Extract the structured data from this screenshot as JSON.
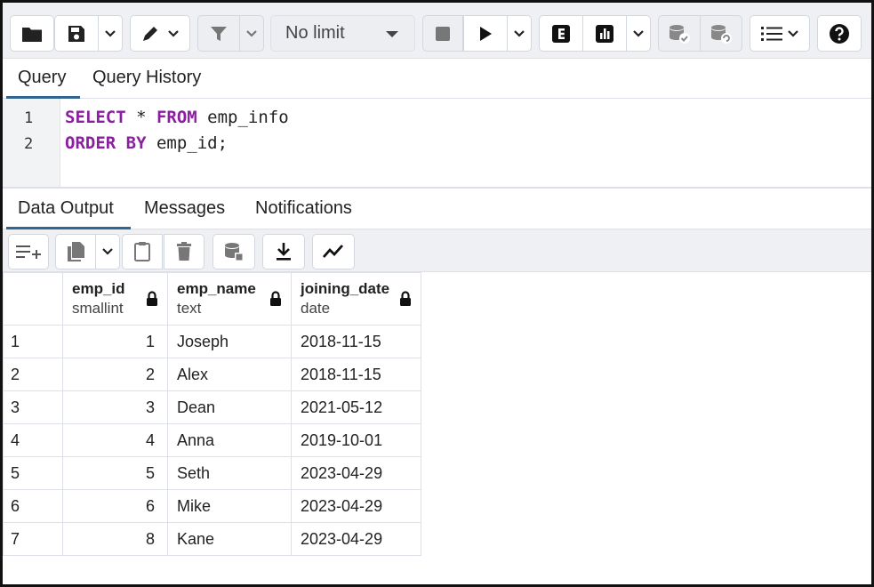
{
  "toolbar": {
    "limit_value": "No limit",
    "icons": [
      "folder-icon",
      "save-icon",
      "chevron-down-icon",
      "pen-icon",
      "filter-icon",
      "stop-icon",
      "play-icon",
      "explain-icon",
      "analyze-icon",
      "commit-icon",
      "rollback-icon",
      "macros-icon",
      "help-icon"
    ]
  },
  "query_tabs": {
    "query": "Query",
    "history": "Query History"
  },
  "editor": {
    "lines": [
      {
        "num": "1",
        "kw1": "SELECT",
        "mid": " * ",
        "kw2": "FROM",
        "rest": " emp_info"
      },
      {
        "num": "2",
        "kw1": "ORDER BY",
        "mid": " emp_id;",
        "kw2": "",
        "rest": ""
      }
    ],
    "keyword_color": "#8b1fa0"
  },
  "output_tabs": {
    "data_output": "Data Output",
    "messages": "Messages",
    "notifications": "Notifications"
  },
  "grid": {
    "columns": [
      {
        "name": "emp_id",
        "type": "smallint"
      },
      {
        "name": "emp_name",
        "type": "text"
      },
      {
        "name": "joining_date",
        "type": "date"
      }
    ],
    "rows": [
      {
        "rn": "1",
        "emp_id": "1",
        "emp_name": "Joseph",
        "joining_date": "2018-11-15"
      },
      {
        "rn": "2",
        "emp_id": "2",
        "emp_name": "Alex",
        "joining_date": "2018-11-15"
      },
      {
        "rn": "3",
        "emp_id": "3",
        "emp_name": "Dean",
        "joining_date": "2021-05-12"
      },
      {
        "rn": "4",
        "emp_id": "4",
        "emp_name": "Anna",
        "joining_date": "2019-10-01"
      },
      {
        "rn": "5",
        "emp_id": "5",
        "emp_name": "Seth",
        "joining_date": "2023-04-29"
      },
      {
        "rn": "6",
        "emp_id": "6",
        "emp_name": "Mike",
        "joining_date": "2023-04-29"
      },
      {
        "rn": "7",
        "emp_id": "8",
        "emp_name": "Kane",
        "joining_date": "2023-04-29"
      }
    ]
  }
}
